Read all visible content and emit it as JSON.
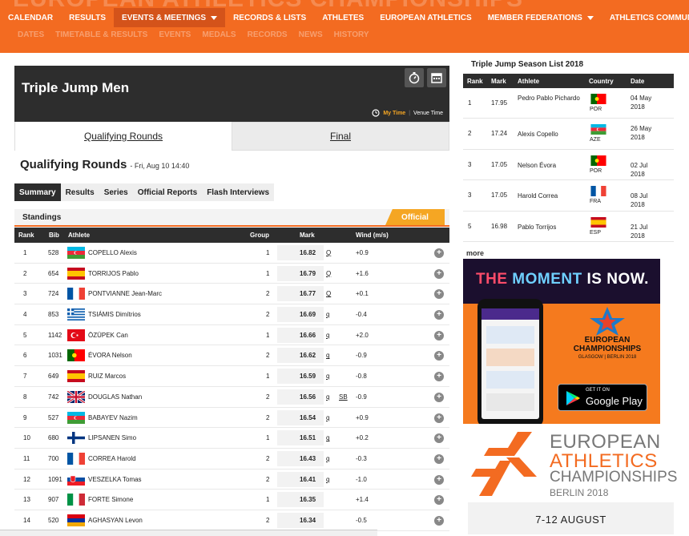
{
  "nav": {
    "ghost_title": "EUROPEAN ATHLETICS CHAMPIONSHIPS",
    "items": [
      {
        "label": "CALENDAR",
        "dropdown": false
      },
      {
        "label": "RESULTS",
        "dropdown": false
      },
      {
        "label": "EVENTS & MEETINGS",
        "dropdown": true,
        "active": true
      },
      {
        "label": "RECORDS & LISTS",
        "dropdown": false
      },
      {
        "label": "ATHLETES",
        "dropdown": false
      },
      {
        "label": "EUROPEAN ATHLETICS",
        "dropdown": false
      },
      {
        "label": "MEMBER FEDERATIONS",
        "dropdown": true
      },
      {
        "label": "ATHLETICS COMMUNITY",
        "dropdown": false
      }
    ],
    "subnav": [
      "DATES",
      "TIMETABLE & RESULTS",
      "EVENTS",
      "MEDALS",
      "RECORDS",
      "NEWS",
      "HISTORY"
    ]
  },
  "event": {
    "title": "Triple Jump Men",
    "my_time": "My Time",
    "venue_time": "Venue Time",
    "round_tabs": [
      "Qualifying Rounds",
      "Final"
    ],
    "round_title": "Qualifying Rounds",
    "round_date": "- Fri, Aug 10 14:40",
    "sub_tabs": [
      "Summary",
      "Results",
      "Series",
      "Official Reports",
      "Flash Interviews"
    ],
    "standings_label": "Standings",
    "official_label": "Official"
  },
  "table": {
    "headers": {
      "rank": "Rank",
      "bib": "Bib",
      "athlete": "Athlete",
      "group": "Group",
      "mark": "Mark",
      "wind": "Wind (m/s)"
    },
    "rows": [
      {
        "rank": "1",
        "bib": "528",
        "flag": "AZE",
        "athlete": "COPELLO Alexis",
        "group": "1",
        "mark": "16.82",
        "q": "Q",
        "note": "",
        "wind": "+0.9"
      },
      {
        "rank": "2",
        "bib": "654",
        "flag": "ESP",
        "athlete": "TORRIJOS Pablo",
        "group": "1",
        "mark": "16.79",
        "q": "Q",
        "note": "",
        "wind": "+1.6"
      },
      {
        "rank": "3",
        "bib": "724",
        "flag": "FRA",
        "athlete": "PONTVIANNE Jean-Marc",
        "group": "2",
        "mark": "16.77",
        "q": "Q",
        "note": "",
        "wind": "+0.1"
      },
      {
        "rank": "4",
        "bib": "853",
        "flag": "GRE",
        "athlete": "TSIÁMIS Dimítrios",
        "group": "2",
        "mark": "16.69",
        "q": "q",
        "note": "",
        "wind": "-0.4"
      },
      {
        "rank": "5",
        "bib": "1142",
        "flag": "TUR",
        "athlete": "ÖZÜPEK Can",
        "group": "1",
        "mark": "16.66",
        "q": "q",
        "note": "",
        "wind": "+2.0"
      },
      {
        "rank": "6",
        "bib": "1031",
        "flag": "POR",
        "athlete": "ÉVORA Nelson",
        "group": "2",
        "mark": "16.62",
        "q": "q",
        "note": "",
        "wind": "-0.9"
      },
      {
        "rank": "7",
        "bib": "649",
        "flag": "ESP",
        "athlete": "RUIZ Marcos",
        "group": "1",
        "mark": "16.59",
        "q": "q",
        "note": "",
        "wind": "-0.8"
      },
      {
        "rank": "8",
        "bib": "742",
        "flag": "GBR",
        "athlete": "DOUGLAS Nathan",
        "group": "2",
        "mark": "16.56",
        "q": "q",
        "note": "SB",
        "wind": "-0.9"
      },
      {
        "rank": "9",
        "bib": "527",
        "flag": "AZE",
        "athlete": "BABAYEV Nazim",
        "group": "2",
        "mark": "16.54",
        "q": "q",
        "note": "",
        "wind": "+0.9"
      },
      {
        "rank": "10",
        "bib": "680",
        "flag": "FIN",
        "athlete": "LIPSANEN Simo",
        "group": "1",
        "mark": "16.51",
        "q": "q",
        "note": "",
        "wind": "+0.2"
      },
      {
        "rank": "11",
        "bib": "700",
        "flag": "FRA",
        "athlete": "CORREA Harold",
        "group": "2",
        "mark": "16.43",
        "q": "q",
        "note": "",
        "wind": "-0.3"
      },
      {
        "rank": "12",
        "bib": "1091",
        "flag": "SVK",
        "athlete": "VESZELKA Tomas",
        "group": "2",
        "mark": "16.41",
        "q": "q",
        "note": "",
        "wind": "-1.0"
      },
      {
        "rank": "13",
        "bib": "907",
        "flag": "ITA",
        "athlete": "FORTE Simone",
        "group": "1",
        "mark": "16.35",
        "q": "",
        "note": "",
        "wind": "+1.4"
      },
      {
        "rank": "14",
        "bib": "520",
        "flag": "ARM",
        "athlete": "AGHASYAN Levon",
        "group": "2",
        "mark": "16.34",
        "q": "",
        "note": "",
        "wind": "-0.5"
      }
    ]
  },
  "season_list": {
    "title": "Triple Jump Season List 2018",
    "headers": {
      "rank": "Rank",
      "mark": "Mark",
      "athlete": "Athlete",
      "country": "Country",
      "date": "Date"
    },
    "rows": [
      {
        "rank": "1",
        "mark": "17.95",
        "athlete": "Pedro Pablo Pichardo",
        "flag": "POR",
        "country": "POR",
        "date": "04 May 2018"
      },
      {
        "rank": "2",
        "mark": "17.24",
        "athlete": "Alexis Copello",
        "flag": "AZE",
        "country": "AZE",
        "date": "26 May 2018"
      },
      {
        "rank": "3",
        "mark": "17.05",
        "athlete": "Nelson Évora",
        "flag": "POR",
        "country": "POR",
        "date": "02 Jul 2018"
      },
      {
        "rank": "3",
        "mark": "17.05",
        "athlete": "Harold Correa",
        "flag": "FRA",
        "country": "FRA",
        "date": "08 Jul 2018"
      },
      {
        "rank": "5",
        "mark": "16.98",
        "athlete": "Pablo Torrijos",
        "flag": "ESP",
        "country": "ESP",
        "date": "21 Jul 2018"
      }
    ],
    "more_label": "more"
  },
  "ad": {
    "headline_the": "THE",
    "headline_moment": "MOMENT",
    "headline_rest": "IS NOW.",
    "logo_text_1": "EUROPEAN",
    "logo_text_2": "CHAMPIONSHIPS",
    "logo_text_3": "GLASGOW | BERLIN 2018",
    "get_it_on": "GET IT ON",
    "store": "Google Play"
  },
  "championships": {
    "line1": "EUROPEAN",
    "line2": "ATHLETICS",
    "line3": "CHAMPIONSHIPS",
    "line4": "BERLIN 2018",
    "dates": "7-12 AUGUST"
  },
  "colors": {
    "brand_orange": "#f36b21",
    "dark": "#2d2d2d",
    "official": "#f5a623"
  }
}
